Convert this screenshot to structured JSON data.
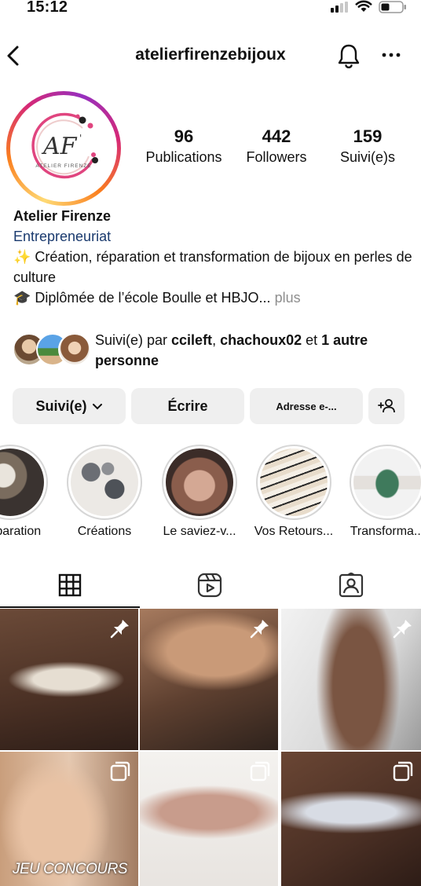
{
  "status_bar": {
    "time": "15:12"
  },
  "header": {
    "username": "atelierfirenzebijoux",
    "icons": [
      "back-chevron-icon",
      "bell-icon",
      "more-icon"
    ]
  },
  "profile": {
    "logo_text": "AF",
    "logo_subtext": "ATELIER FIRENZE",
    "stats": [
      {
        "value": "96",
        "label": "Publications"
      },
      {
        "value": "442",
        "label": "Followers"
      },
      {
        "value": "159",
        "label": "Suivi(e)s"
      }
    ],
    "name": "Atelier Firenze",
    "category": "Entrepreneuriat",
    "bio_line1": "✨ Création, réparation et transformation de bijoux en perles de culture",
    "bio_line2": "🎓 Diplômée de l’école Boulle et HBJO...",
    "bio_more": "plus"
  },
  "followed_by": {
    "prefix": "Suivi(e) par ",
    "user1": "ccileft",
    "sep": ", ",
    "user2": "chachoux02",
    "and": " et ",
    "others": "1 autre personne"
  },
  "buttons": {
    "follow": "Suivi(e)",
    "message": "Écrire",
    "email": "Adresse e-..."
  },
  "highlights": [
    {
      "label": "Réparation"
    },
    {
      "label": "Créations"
    },
    {
      "label": "Le saviez-v..."
    },
    {
      "label": "Vos Retours..."
    },
    {
      "label": "Transforma..."
    }
  ],
  "tabs": [
    "grid-icon",
    "reels-icon",
    "tagged-icon"
  ],
  "posts": [
    {
      "badge": "pin-icon",
      "caption": ""
    },
    {
      "badge": "pin-icon",
      "caption": ""
    },
    {
      "badge": "pin-icon",
      "caption": ""
    },
    {
      "badge": "carousel-icon",
      "caption": "JEU CONCOURS"
    },
    {
      "badge": "carousel-icon",
      "caption": ""
    },
    {
      "badge": "carousel-icon",
      "caption": ""
    }
  ],
  "colors": {
    "category_link": "#1a3a6e",
    "button_bg": "#efefef",
    "muted": "#8e8e8e",
    "logo_pink": "#e0457f"
  }
}
